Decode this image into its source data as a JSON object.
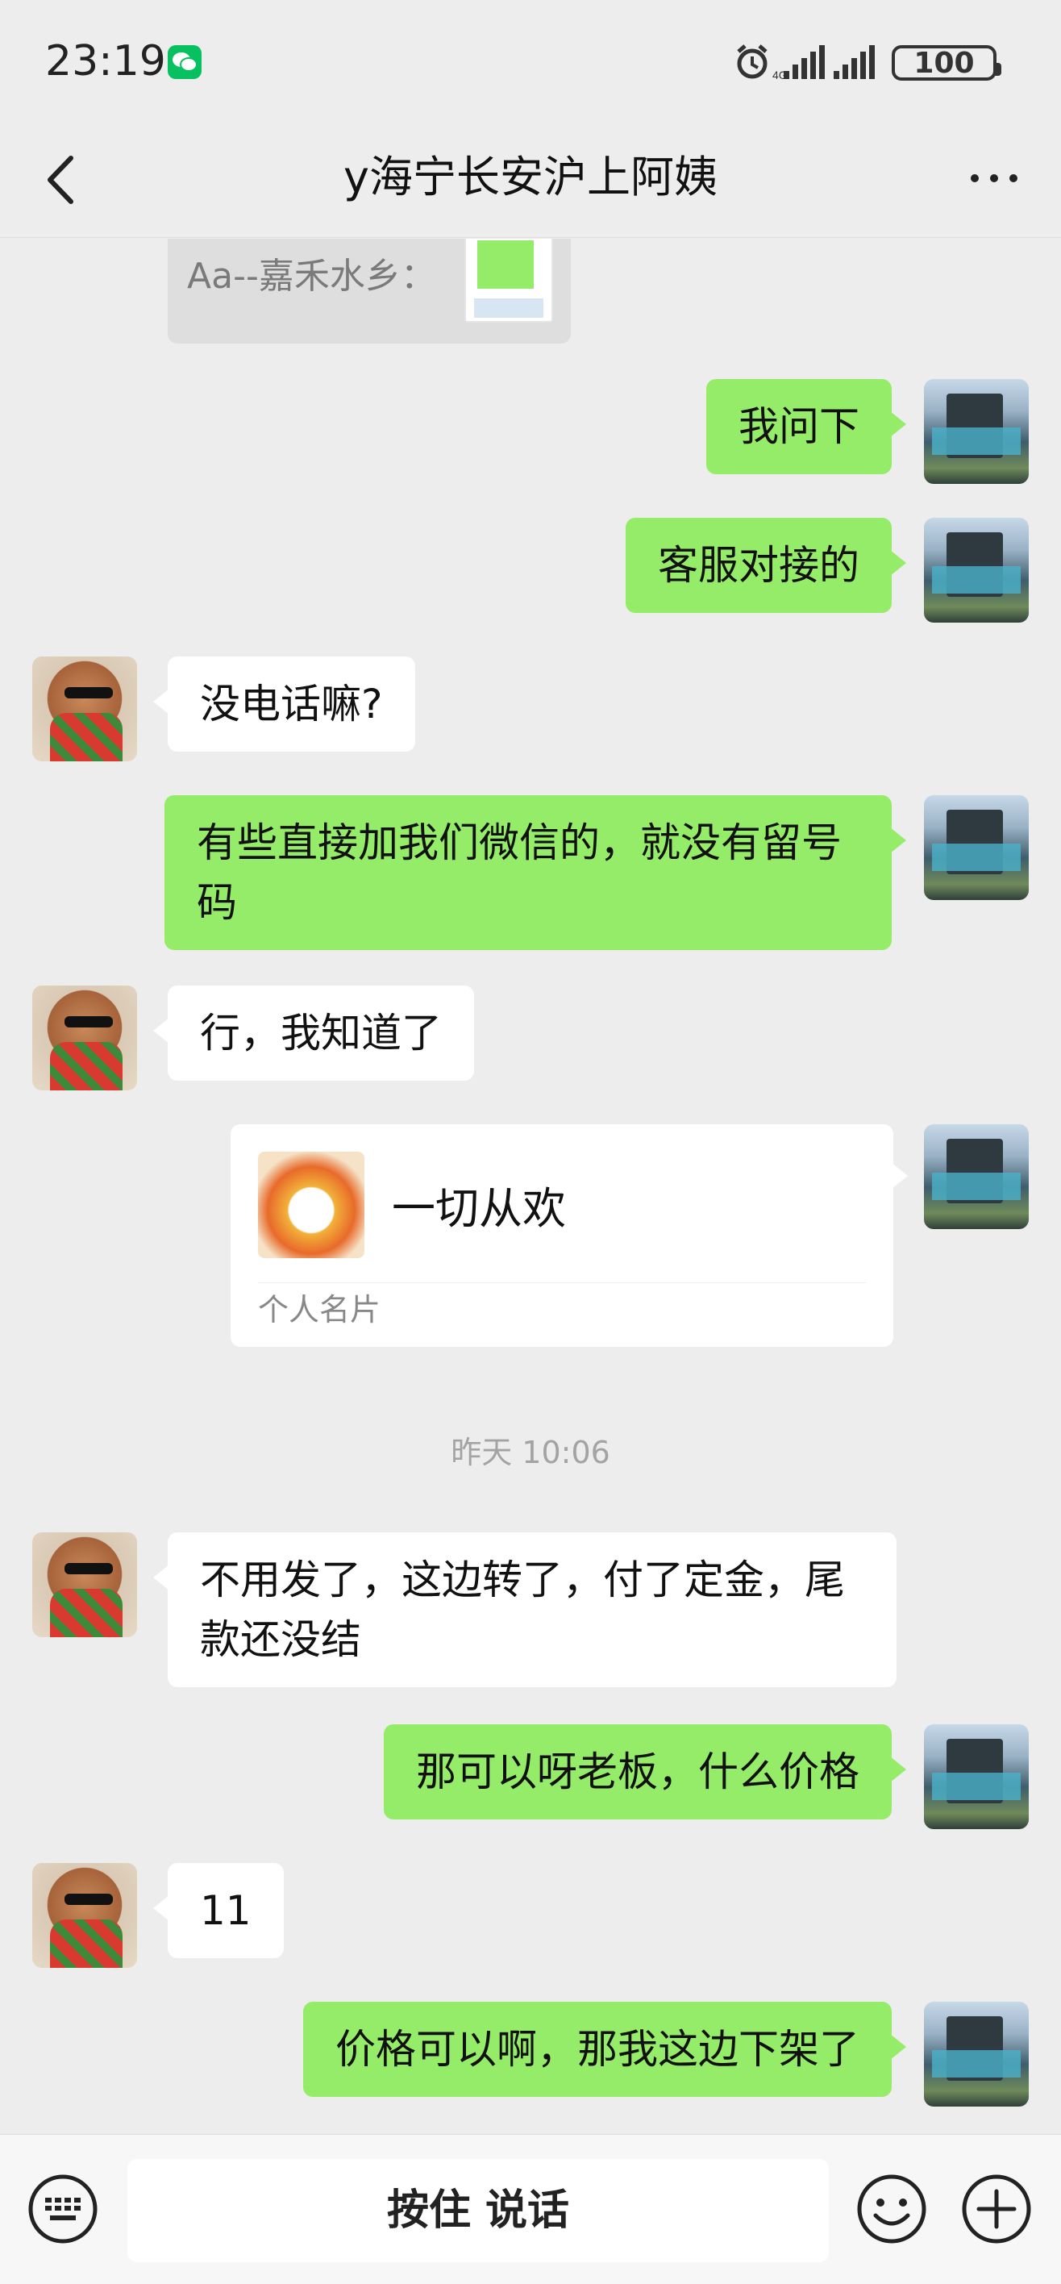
{
  "status_bar": {
    "time": "23:19",
    "battery": "100",
    "icons": [
      "wechat-icon",
      "alarm-icon",
      "signal-icon",
      "signal-icon",
      "battery-icon"
    ]
  },
  "nav": {
    "title": "y海宁长安沪上阿姨",
    "back_icon": "chevron-left-icon",
    "more_icon": "more-dots-icon"
  },
  "chat": {
    "quoted_message": {
      "text": "Aa--嘉禾水乡："
    },
    "messages": [
      {
        "side": "self",
        "text": "我问下"
      },
      {
        "side": "self",
        "text": "客服对接的"
      },
      {
        "side": "other",
        "text": "没电话嘛?"
      },
      {
        "side": "self",
        "text": "有些直接加我们微信的，就没有留号码"
      },
      {
        "side": "other",
        "text": "行，我知道了"
      },
      {
        "side": "self",
        "type": "contact_card",
        "name": "一切从欢",
        "label": "个人名片"
      },
      {
        "type": "timestamp",
        "text": "昨天 10:06"
      },
      {
        "side": "other",
        "text": "不用发了，这边转了，付了定金，尾款还没结"
      },
      {
        "side": "self",
        "text": "那可以呀老板，什么价格"
      },
      {
        "side": "other",
        "text": "11"
      },
      {
        "side": "self",
        "text": "价格可以啊，那我这边下架了"
      }
    ]
  },
  "input_bar": {
    "hold_to_talk": "按住 说话",
    "icons": [
      "keyboard-icon",
      "emoji-icon",
      "plus-icon"
    ]
  },
  "colors": {
    "background": "#ededed",
    "self_bubble": "#95ec69",
    "other_bubble": "#ffffff",
    "wechat_green": "#07c160"
  }
}
